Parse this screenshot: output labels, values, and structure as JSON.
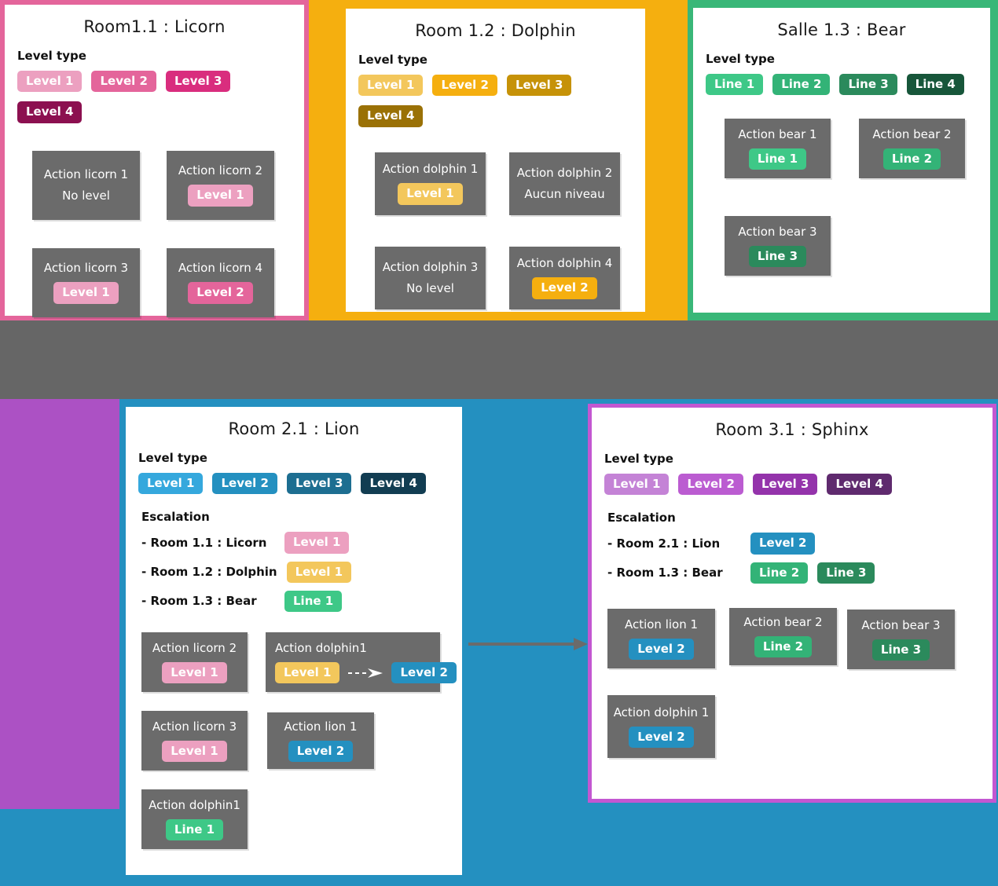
{
  "colors": {
    "pink_1": "#ecA0c0",
    "pink_2": "#e4659b",
    "pink_3": "#d92d7e",
    "pink_4": "#8c1050",
    "orange_1": "#f3c75c",
    "orange_2": "#f5af0f",
    "orange_3": "#c69208",
    "orange_4": "#9a7106",
    "green_1": "#3ec887",
    "green_2": "#33b377",
    "green_3": "#2b8a5c",
    "green_4": "#17563a",
    "blue_1": "#35a8dd",
    "blue_2": "#2490c0",
    "blue_3": "#1d6e91",
    "blue_4": "#123d52",
    "purple_1": "#c483d6",
    "purple_2": "#bb5cd1",
    "purple_3": "#9433ab",
    "purple_4": "#5f2a6e",
    "card_bg": "#6b6b6b",
    "band_gray": "#666666",
    "panel_bg": "#ffffff"
  },
  "background": {
    "band_pink": "#e4659b",
    "band_orange": "#f5af0f",
    "band_green": "#39b778",
    "band_gray": "#666666",
    "band_purple": "#ac51c4",
    "band_blue": "#2490c0"
  },
  "panels": [
    {
      "id": "licorn",
      "title": "Room1.1 : Licorn",
      "level_type_label": "Level type",
      "levels": [
        {
          "label": "Level 1",
          "color": "#ecA0c0"
        },
        {
          "label": "Level 2",
          "color": "#e4659b"
        },
        {
          "label": "Level 3",
          "color": "#d92d7e"
        },
        {
          "label": "Level 4",
          "color": "#8c1050"
        }
      ],
      "cards": [
        {
          "title": "Action licorn  1",
          "no_level_text": "No level",
          "chips": []
        },
        {
          "title": "Action licorn 2",
          "chips": [
            {
              "label": "Level 1",
              "color": "#ecA0c0"
            }
          ]
        },
        {
          "title": "Action licorn 3",
          "chips": [
            {
              "label": "Level 1",
              "color": "#ecA0c0"
            }
          ]
        },
        {
          "title": "Action licorn 4",
          "chips": [
            {
              "label": "Level 2",
              "color": "#e4659b"
            }
          ]
        }
      ]
    },
    {
      "id": "dolphin",
      "title": "Room 1.2 : Dolphin",
      "level_type_label": "Level type",
      "levels": [
        {
          "label": "Level 1",
          "color": "#f3c75c"
        },
        {
          "label": "Level 2",
          "color": "#f5af0f"
        },
        {
          "label": "Level 3",
          "color": "#c69208"
        },
        {
          "label": "Level 4",
          "color": "#9a7106"
        }
      ],
      "cards": [
        {
          "title": "Action dolphin 1",
          "chips": [
            {
              "label": "Level 1",
              "color": "#f3c75c"
            }
          ]
        },
        {
          "title": "Action dolphin 2",
          "no_level_text": "Aucun niveau",
          "chips": []
        },
        {
          "title": "Action dolphin 3",
          "no_level_text": "No level",
          "chips": []
        },
        {
          "title": "Action dolphin 4",
          "chips": [
            {
              "label": "Level 2",
              "color": "#f5af0f"
            }
          ]
        }
      ]
    },
    {
      "id": "bear",
      "title": "Salle 1.3 : Bear",
      "level_type_label": "Level type",
      "levels": [
        {
          "label": "Line 1",
          "color": "#3ec887"
        },
        {
          "label": "Line 2",
          "color": "#33b377"
        },
        {
          "label": "Line 3",
          "color": "#2b8a5c"
        },
        {
          "label": "Line 4",
          "color": "#17563a"
        }
      ],
      "cards": [
        {
          "title": "Action bear 1",
          "chips": [
            {
              "label": "Line 1",
              "color": "#3ec887"
            }
          ]
        },
        {
          "title": "Action bear 2",
          "chips": [
            {
              "label": "Line 2",
              "color": "#33b377"
            }
          ]
        },
        {
          "title": "Action bear 3",
          "chips": [
            {
              "label": "Line 3",
              "color": "#2b8a5c"
            }
          ]
        }
      ]
    },
    {
      "id": "lion",
      "title": "Room 2.1 : Lion",
      "level_type_label": "Level type",
      "escalation_label": "Escalation",
      "levels": [
        {
          "label": "Level 1",
          "color": "#35a8dd"
        },
        {
          "label": "Level 2",
          "color": "#2490c0"
        },
        {
          "label": "Level 3",
          "color": "#1d6e91"
        },
        {
          "label": "Level 4",
          "color": "#123d52"
        }
      ],
      "escalation": [
        {
          "label": "- Room 1.1 : Licorn",
          "chips": [
            {
              "label": "Level 1",
              "color": "#ecA0c0"
            }
          ]
        },
        {
          "label": "- Room 1.2 : Dolphin",
          "chips": [
            {
              "label": "Level 1",
              "color": "#f3c75c"
            }
          ]
        },
        {
          "label": "- Room 1.3 : Bear",
          "chips": [
            {
              "label": "Line 1",
              "color": "#3ec887"
            }
          ]
        }
      ],
      "cards": [
        {
          "title": "Action licorn 2",
          "chips": [
            {
              "label": "Level 1",
              "color": "#ecA0c0"
            }
          ]
        },
        {
          "title": "Action dolphin1",
          "chips": [
            {
              "label": "Level 1",
              "color": "#f3c75c"
            },
            {
              "label": "Level 2",
              "color": "#2490c0"
            }
          ],
          "arrow_between": true
        },
        {
          "title": "Action licorn 3",
          "chips": [
            {
              "label": "Level 1",
              "color": "#ecA0c0"
            }
          ]
        },
        {
          "title": "Action lion 1",
          "chips": [
            {
              "label": "Level 2",
              "color": "#2490c0"
            }
          ]
        },
        {
          "title": "Action dolphin1",
          "chips": [
            {
              "label": "Line 1",
              "color": "#3ec887"
            }
          ]
        }
      ]
    },
    {
      "id": "sphinx",
      "title": "Room 3.1 : Sphinx",
      "level_type_label": "Level type",
      "escalation_label": "Escalation",
      "levels": [
        {
          "label": "Level 1",
          "color": "#c483d6"
        },
        {
          "label": "Level 2",
          "color": "#bb5cd1"
        },
        {
          "label": "Level 3",
          "color": "#9433ab"
        },
        {
          "label": "Level 4",
          "color": "#5f2a6e"
        }
      ],
      "escalation": [
        {
          "label": "- Room 2.1 : Lion",
          "chips": [
            {
              "label": "Level 2",
              "color": "#2490c0"
            }
          ]
        },
        {
          "label": "- Room 1.3 : Bear",
          "chips": [
            {
              "label": "Line 2",
              "color": "#33b377"
            },
            {
              "label": "Line 3",
              "color": "#2b8a5c"
            }
          ]
        }
      ],
      "cards": [
        {
          "title": "Action lion 1",
          "chips": [
            {
              "label": "Level 2",
              "color": "#2490c0"
            }
          ]
        },
        {
          "title": "Action bear 2",
          "chips": [
            {
              "label": "Line 2",
              "color": "#33b377"
            }
          ]
        },
        {
          "title": "Action bear 3",
          "chips": [
            {
              "label": "Line 3",
              "color": "#2b8a5c"
            }
          ]
        },
        {
          "title": "Action dolphin 1",
          "chips": [
            {
              "label": "Level 2",
              "color": "#2490c0"
            }
          ]
        }
      ]
    }
  ],
  "connectors": [
    {
      "name": "lion-to-sphinx-arrow",
      "color": "#6b6b6b"
    }
  ]
}
